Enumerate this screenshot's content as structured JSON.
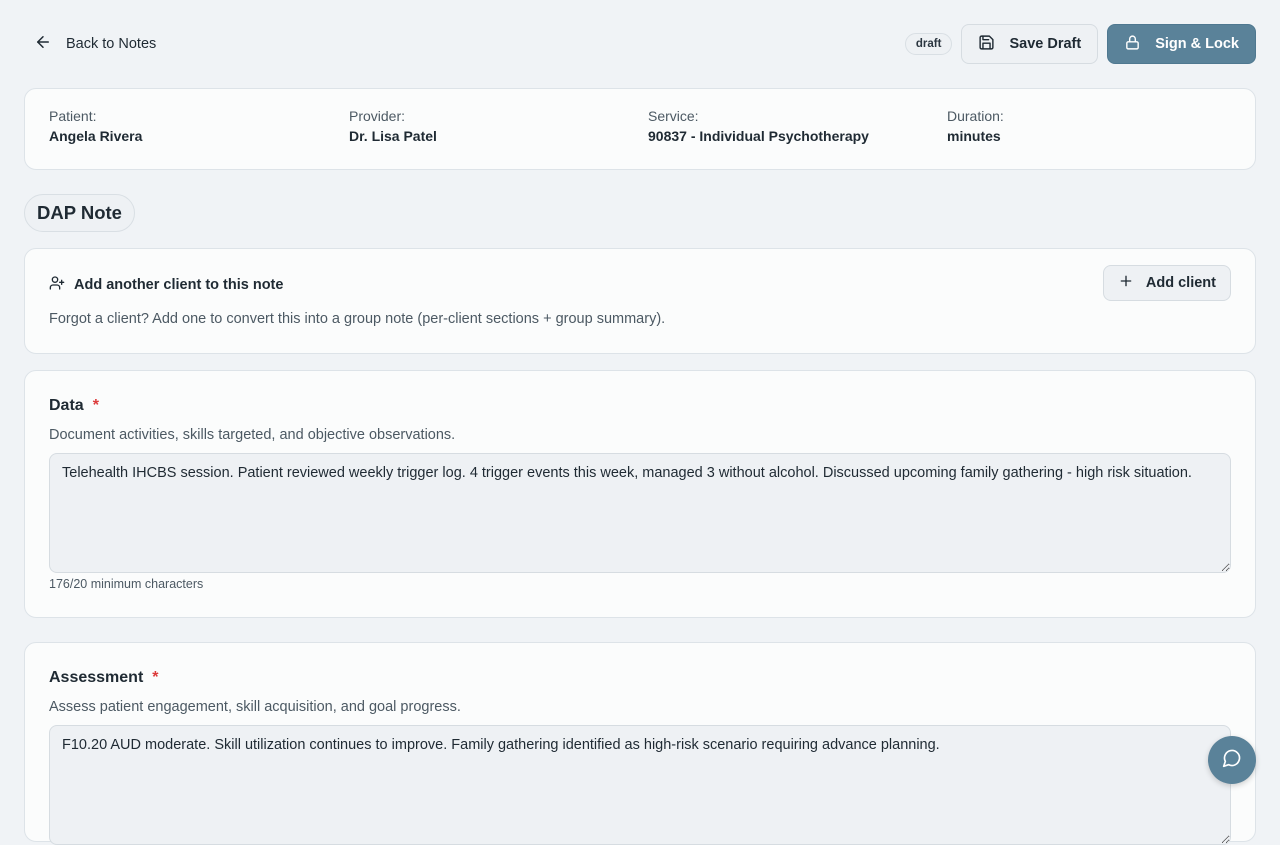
{
  "header": {
    "back_label": "Back to Notes",
    "status_badge": "draft",
    "save_draft_label": "Save Draft",
    "sign_lock_label": "Sign & Lock"
  },
  "info": {
    "patient_label": "Patient:",
    "patient_value": "Angela Rivera",
    "provider_label": "Provider:",
    "provider_value": "Dr. Lisa Patel",
    "service_label": "Service:",
    "service_value": "90837 - Individual Psychotherapy",
    "duration_label": "Duration:",
    "duration_value": "minutes"
  },
  "note_type": "DAP Note",
  "add_client": {
    "title": "Add another client to this note",
    "description": "Forgot a client? Add one to convert this into a group note (per-client sections + group summary).",
    "button_label": "Add client"
  },
  "sections": {
    "data": {
      "title": "Data",
      "required_mark": "*",
      "description": "Document activities, skills targeted, and objective observations.",
      "value": "Telehealth IHCBS session. Patient reviewed weekly trigger log. 4 trigger events this week, managed 3 without alcohol. Discussed upcoming family gathering - high risk situation.",
      "char_count": "176/20 minimum characters"
    },
    "assessment": {
      "title": "Assessment",
      "required_mark": "*",
      "description": "Assess patient engagement, skill acquisition, and goal progress.",
      "value": "F10.20 AUD moderate. Skill utilization continues to improve. Family gathering identified as high-risk scenario requiring advance planning."
    }
  },
  "colors": {
    "primary": "#5a8299",
    "background": "#f0f3f6",
    "required": "#dc3b3b"
  },
  "icons": {
    "back": "arrow-left-icon",
    "save": "save-icon",
    "lock": "lock-icon",
    "add_user": "user-plus-icon",
    "plus": "plus-icon",
    "chat": "message-circle-icon"
  }
}
